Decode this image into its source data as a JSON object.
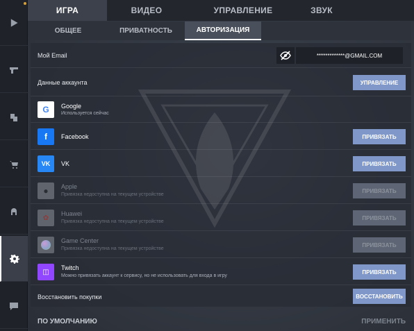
{
  "top_tabs": [
    {
      "label": "ИГРА",
      "active": true
    },
    {
      "label": "ВИДЕО",
      "active": false
    },
    {
      "label": "УПРАВЛЕНИЕ",
      "active": false
    },
    {
      "label": "ЗВУК",
      "active": false
    }
  ],
  "sub_tabs": [
    {
      "label": "ОБЩЕЕ",
      "active": false
    },
    {
      "label": "ПРИВАТНОСТЬ",
      "active": false
    },
    {
      "label": "АВТОРИЗАЦИЯ",
      "active": true
    }
  ],
  "sidebar": {
    "items": [
      {
        "icon": "play-icon"
      },
      {
        "icon": "pistol-icon"
      },
      {
        "icon": "inventory-icon"
      },
      {
        "icon": "cart-icon"
      },
      {
        "icon": "helmet-icon"
      },
      {
        "icon": "gear-icon",
        "active": true
      },
      {
        "icon": "chat-icon"
      }
    ]
  },
  "account": {
    "email_label": "Мой Email",
    "email_value": "*************@GMAIL.COM",
    "eye_icon": "eye-hidden-icon",
    "account_data_label": "Данные аккаунта",
    "manage_button": "УПРАВЛЕНИЕ"
  },
  "providers": [
    {
      "name": "Google",
      "status": "Используется сейчас",
      "icon": "google-icon",
      "button": "",
      "disabled": false
    },
    {
      "name": "Facebook",
      "status": "",
      "icon": "facebook-icon",
      "button": "ПРИВЯЗАТЬ",
      "disabled": false
    },
    {
      "name": "VK",
      "status": "",
      "icon": "vk-icon",
      "button": "ПРИВЯЗАТЬ",
      "disabled": false
    },
    {
      "name": "Apple",
      "status": "Привязка недоступна на текущем устройстве",
      "icon": "apple-icon",
      "button": "ПРИВЯЗАТЬ",
      "disabled": true
    },
    {
      "name": "Huawei",
      "status": "Привязка недоступна на текущем устройстве",
      "icon": "huawei-icon",
      "button": "ПРИВЯЗАТЬ",
      "disabled": true
    },
    {
      "name": "Game Center",
      "status": "Привязка недоступна на текущем устройстве",
      "icon": "game-center-icon",
      "button": "ПРИВЯЗАТЬ",
      "disabled": true
    },
    {
      "name": "Twitch",
      "status": "Можно привязать аккаунт к сервису, но не использовать для входа в игру",
      "icon": "twitch-icon",
      "button": "ПРИВЯЗАТЬ",
      "disabled": false
    }
  ],
  "restore": {
    "label": "Восстановить покупки",
    "button": "ВОССТАНОВИТЬ"
  },
  "footer": {
    "defaults": "ПО УМОЛЧАНИЮ",
    "apply": "ПРИМЕНИТЬ"
  },
  "colors": {
    "accent_button": "#7f97c9",
    "disabled_button": "#5e6675",
    "facebook": "#1877f2",
    "vk": "#2787f5",
    "twitch": "#9146ff"
  }
}
